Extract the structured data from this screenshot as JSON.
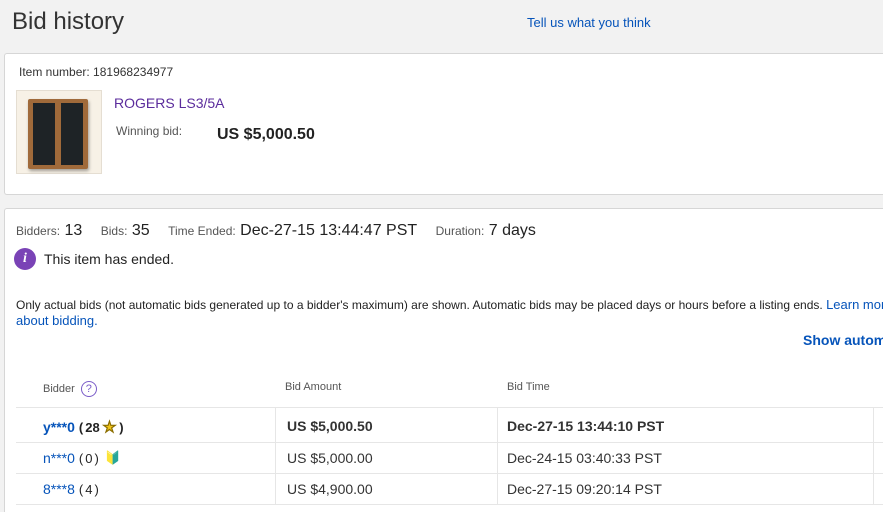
{
  "header": {
    "title": "Bid history",
    "feedback_link": "Tell us what you think"
  },
  "item": {
    "number_label": "Item number:",
    "number": "181968234977",
    "title": "ROGERS LS3/5A",
    "winning_bid_label": "Winning bid:",
    "winning_bid": "US $5,000.50"
  },
  "summary": {
    "bidders_label": "Bidders:",
    "bidders": "13",
    "bids_label": "Bids:",
    "bids": "35",
    "time_ended_label": "Time Ended:",
    "time_ended": "Dec-27-15 13:44:47 PST",
    "duration_label": "Duration:",
    "duration": "7 days"
  },
  "status": {
    "icon": "info-icon",
    "text": "This item has ended."
  },
  "notice": {
    "text": "Only actual bids (not automatic bids generated up to a bidder's maximum) are shown. Automatic bids may be placed days or hours before a listing ends.",
    "link": "Learn more about bidding."
  },
  "show_automatic": "Show automatic bids",
  "table": {
    "headers": {
      "bidder": "Bidder",
      "amount": "Bid Amount",
      "time": "Bid Time"
    },
    "rows": [
      {
        "bidder": "y***0",
        "fb_open": "(",
        "feedback": "28",
        "fb_close": ")",
        "icon": "star-icon",
        "amount": "US $5,000.50",
        "time": "Dec-27-15 13:44:10 PST"
      },
      {
        "bidder": "n***0",
        "fb_open": "(",
        "feedback": "0",
        "fb_close": ")",
        "icon": "new-user-icon",
        "amount": "US $5,000.00",
        "time": "Dec-24-15 03:40:33 PST"
      },
      {
        "bidder": "8***8",
        "fb_open": "(",
        "feedback": "4",
        "fb_close": ")",
        "amount": "US $4,900.00",
        "time": "Dec-27-15 09:20:14 PST"
      }
    ]
  },
  "colors": {
    "link": "#0654ba",
    "item_title": "#5b2c9c",
    "info_badge": "#7a43b6"
  }
}
